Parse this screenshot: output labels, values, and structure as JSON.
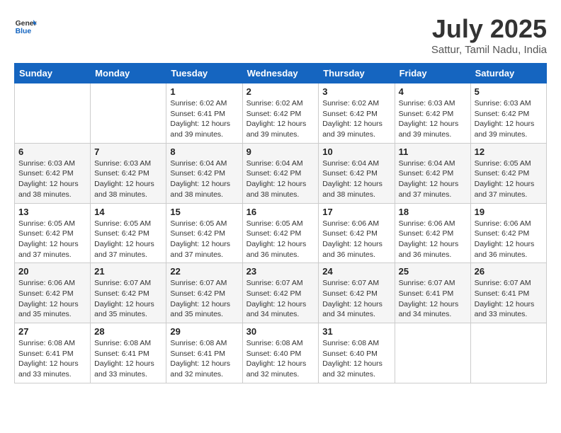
{
  "header": {
    "logo_line1": "General",
    "logo_line2": "Blue",
    "title": "July 2025",
    "subtitle": "Sattur, Tamil Nadu, India"
  },
  "weekdays": [
    "Sunday",
    "Monday",
    "Tuesday",
    "Wednesday",
    "Thursday",
    "Friday",
    "Saturday"
  ],
  "weeks": [
    [
      {
        "day": "",
        "info": ""
      },
      {
        "day": "",
        "info": ""
      },
      {
        "day": "1",
        "info": "Sunrise: 6:02 AM\nSunset: 6:41 PM\nDaylight: 12 hours and 39 minutes."
      },
      {
        "day": "2",
        "info": "Sunrise: 6:02 AM\nSunset: 6:42 PM\nDaylight: 12 hours and 39 minutes."
      },
      {
        "day": "3",
        "info": "Sunrise: 6:02 AM\nSunset: 6:42 PM\nDaylight: 12 hours and 39 minutes."
      },
      {
        "day": "4",
        "info": "Sunrise: 6:03 AM\nSunset: 6:42 PM\nDaylight: 12 hours and 39 minutes."
      },
      {
        "day": "5",
        "info": "Sunrise: 6:03 AM\nSunset: 6:42 PM\nDaylight: 12 hours and 39 minutes."
      }
    ],
    [
      {
        "day": "6",
        "info": "Sunrise: 6:03 AM\nSunset: 6:42 PM\nDaylight: 12 hours and 38 minutes."
      },
      {
        "day": "7",
        "info": "Sunrise: 6:03 AM\nSunset: 6:42 PM\nDaylight: 12 hours and 38 minutes."
      },
      {
        "day": "8",
        "info": "Sunrise: 6:04 AM\nSunset: 6:42 PM\nDaylight: 12 hours and 38 minutes."
      },
      {
        "day": "9",
        "info": "Sunrise: 6:04 AM\nSunset: 6:42 PM\nDaylight: 12 hours and 38 minutes."
      },
      {
        "day": "10",
        "info": "Sunrise: 6:04 AM\nSunset: 6:42 PM\nDaylight: 12 hours and 38 minutes."
      },
      {
        "day": "11",
        "info": "Sunrise: 6:04 AM\nSunset: 6:42 PM\nDaylight: 12 hours and 37 minutes."
      },
      {
        "day": "12",
        "info": "Sunrise: 6:05 AM\nSunset: 6:42 PM\nDaylight: 12 hours and 37 minutes."
      }
    ],
    [
      {
        "day": "13",
        "info": "Sunrise: 6:05 AM\nSunset: 6:42 PM\nDaylight: 12 hours and 37 minutes."
      },
      {
        "day": "14",
        "info": "Sunrise: 6:05 AM\nSunset: 6:42 PM\nDaylight: 12 hours and 37 minutes."
      },
      {
        "day": "15",
        "info": "Sunrise: 6:05 AM\nSunset: 6:42 PM\nDaylight: 12 hours and 37 minutes."
      },
      {
        "day": "16",
        "info": "Sunrise: 6:05 AM\nSunset: 6:42 PM\nDaylight: 12 hours and 36 minutes."
      },
      {
        "day": "17",
        "info": "Sunrise: 6:06 AM\nSunset: 6:42 PM\nDaylight: 12 hours and 36 minutes."
      },
      {
        "day": "18",
        "info": "Sunrise: 6:06 AM\nSunset: 6:42 PM\nDaylight: 12 hours and 36 minutes."
      },
      {
        "day": "19",
        "info": "Sunrise: 6:06 AM\nSunset: 6:42 PM\nDaylight: 12 hours and 36 minutes."
      }
    ],
    [
      {
        "day": "20",
        "info": "Sunrise: 6:06 AM\nSunset: 6:42 PM\nDaylight: 12 hours and 35 minutes."
      },
      {
        "day": "21",
        "info": "Sunrise: 6:07 AM\nSunset: 6:42 PM\nDaylight: 12 hours and 35 minutes."
      },
      {
        "day": "22",
        "info": "Sunrise: 6:07 AM\nSunset: 6:42 PM\nDaylight: 12 hours and 35 minutes."
      },
      {
        "day": "23",
        "info": "Sunrise: 6:07 AM\nSunset: 6:42 PM\nDaylight: 12 hours and 34 minutes."
      },
      {
        "day": "24",
        "info": "Sunrise: 6:07 AM\nSunset: 6:42 PM\nDaylight: 12 hours and 34 minutes."
      },
      {
        "day": "25",
        "info": "Sunrise: 6:07 AM\nSunset: 6:41 PM\nDaylight: 12 hours and 34 minutes."
      },
      {
        "day": "26",
        "info": "Sunrise: 6:07 AM\nSunset: 6:41 PM\nDaylight: 12 hours and 33 minutes."
      }
    ],
    [
      {
        "day": "27",
        "info": "Sunrise: 6:08 AM\nSunset: 6:41 PM\nDaylight: 12 hours and 33 minutes."
      },
      {
        "day": "28",
        "info": "Sunrise: 6:08 AM\nSunset: 6:41 PM\nDaylight: 12 hours and 33 minutes."
      },
      {
        "day": "29",
        "info": "Sunrise: 6:08 AM\nSunset: 6:41 PM\nDaylight: 12 hours and 32 minutes."
      },
      {
        "day": "30",
        "info": "Sunrise: 6:08 AM\nSunset: 6:40 PM\nDaylight: 12 hours and 32 minutes."
      },
      {
        "day": "31",
        "info": "Sunrise: 6:08 AM\nSunset: 6:40 PM\nDaylight: 12 hours and 32 minutes."
      },
      {
        "day": "",
        "info": ""
      },
      {
        "day": "",
        "info": ""
      }
    ]
  ]
}
